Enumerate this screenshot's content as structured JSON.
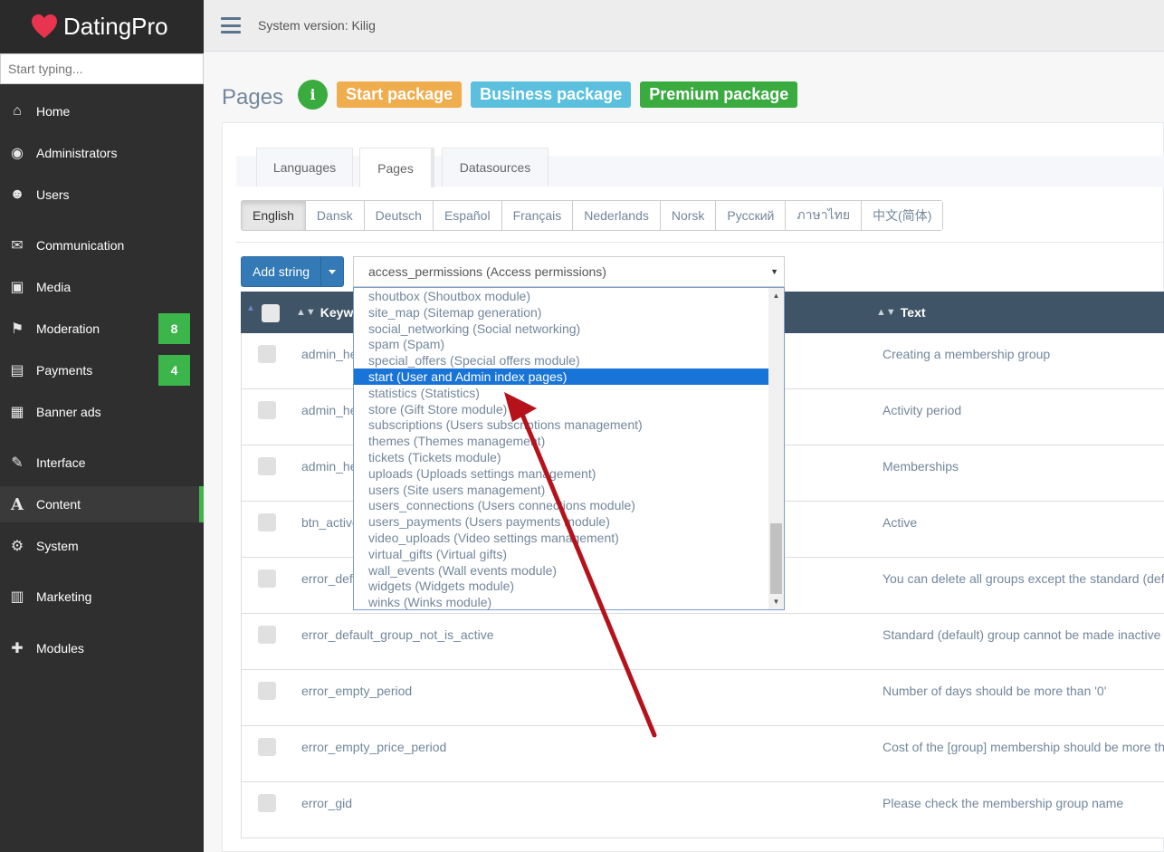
{
  "app": {
    "name": "DatingPro",
    "brand_color": "#e8344e"
  },
  "search": {
    "placeholder": "Start typing..."
  },
  "topbar": {
    "system_version": "System version: Kilig"
  },
  "sidebar": {
    "items": [
      {
        "label": "Home",
        "icon": "home-icon"
      },
      {
        "label": "Administrators",
        "icon": "eye-icon"
      },
      {
        "label": "Users",
        "icon": "users-icon"
      },
      {
        "label": "Communication",
        "icon": "chat-icon"
      },
      {
        "label": "Media",
        "icon": "image-icon"
      },
      {
        "label": "Moderation",
        "icon": "flag-icon",
        "badge": "8"
      },
      {
        "label": "Payments",
        "icon": "money-icon",
        "badge": "4"
      },
      {
        "label": "Banner ads",
        "icon": "grid-icon"
      },
      {
        "label": "Interface",
        "icon": "brush-icon"
      },
      {
        "label": "Content",
        "icon": "font-icon",
        "active": true
      },
      {
        "label": "System",
        "icon": "gear-icon"
      },
      {
        "label": "Marketing",
        "icon": "marketing-icon"
      },
      {
        "label": "Modules",
        "icon": "puzzle-icon"
      }
    ]
  },
  "page": {
    "title": "Pages",
    "info_label": "i",
    "packages": [
      "Start package",
      "Business package",
      "Premium package"
    ]
  },
  "tabs": [
    {
      "label": "Languages"
    },
    {
      "label": "Pages",
      "active": true
    },
    {
      "label": "Datasources"
    }
  ],
  "languages": [
    "English",
    "Dansk",
    "Deutsch",
    "Español",
    "Français",
    "Nederlands",
    "Norsk",
    "Русский",
    "ภาษาไทย",
    "中文(简体)"
  ],
  "active_language": "English",
  "toolbar": {
    "add_string_label": "Add string"
  },
  "module_select": {
    "value": "access_permissions (Access permissions)",
    "options": [
      "shoutbox (Shoutbox module)",
      "site_map (Sitemap generation)",
      "social_networking (Social networking)",
      "spam (Spam)",
      "special_offers (Special offers module)",
      "start (User and Admin index pages)",
      "statistics (Statistics)",
      "store (Gift Store module)",
      "subscriptions (Users subscriptions management)",
      "themes (Themes management)",
      "tickets (Tickets module)",
      "uploads (Uploads settings management)",
      "users (Site users management)",
      "users_connections (Users connections module)",
      "users_payments (Users payments module)",
      "video_uploads (Video settings management)",
      "virtual_gifts (Virtual gifts)",
      "wall_events (Wall events module)",
      "widgets (Widgets module)",
      "winks (Winks module)"
    ],
    "highlighted": "start (User and Admin index pages)"
  },
  "table": {
    "columns": [
      "Keyword",
      "Text"
    ],
    "rows": [
      {
        "keyword": "admin_he",
        "text": "Creating a membership group"
      },
      {
        "keyword": "admin_he",
        "text": "Activity period"
      },
      {
        "keyword": "admin_he",
        "text": "Memberships"
      },
      {
        "keyword": "btn_active",
        "text": "Active"
      },
      {
        "keyword": "error_def",
        "text": "You can delete all groups except the standard (def"
      },
      {
        "keyword": "error_default_group_not_is_active",
        "text": "Standard (default) group cannot be made inactive"
      },
      {
        "keyword": "error_empty_period",
        "text": "Number of days should be more than '0'"
      },
      {
        "keyword": "error_empty_price_period",
        "text": "Cost of the [group] membership should be more th"
      },
      {
        "keyword": "error_gid",
        "text": "Please check the membership group name"
      }
    ]
  },
  "annotation": {
    "arrow_color": "#b5121b"
  }
}
